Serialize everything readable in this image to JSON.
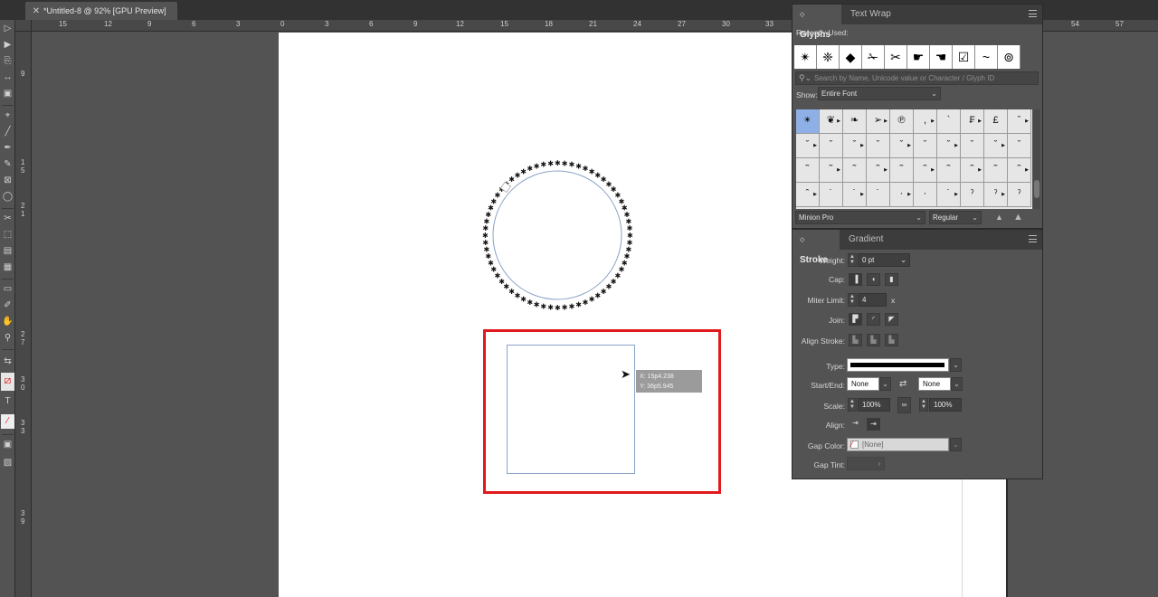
{
  "document_tab": {
    "close_icon": "close-icon",
    "title": "*Untitled-8 @ 92% [GPU Preview]"
  },
  "rulers": {
    "horizontal_labels": [
      "15",
      "12",
      "9",
      "6",
      "3",
      "0",
      "3",
      "6",
      "9",
      "12",
      "15",
      "18",
      "21",
      "24",
      "27",
      "30",
      "33",
      "54",
      "57"
    ],
    "vertical_labels": [
      "9",
      "1 5",
      "2 1",
      "2 7",
      "3 0",
      "3 3",
      "3 9"
    ]
  },
  "canvas": {
    "coordinate_readout": {
      "x": "X: 15p4.238",
      "y": "Y: 36p5.945"
    }
  },
  "glyphs_panel": {
    "tabs": [
      "Glyphs",
      "Text Wrap"
    ],
    "recently_used_label": "Recently Used:",
    "recently_used": [
      "✴",
      "❈",
      "◆",
      "✁",
      "✂",
      "☛",
      "☚",
      "☑",
      "~",
      "⊚"
    ],
    "search_placeholder": "Search by Name, Unicode value or Character / Glyph ID",
    "show_label": "Show:",
    "show_value": "Entire Font",
    "grid": [
      [
        "✴",
        "❦",
        "❧",
        "➢",
        "℗",
        ",",
        "`",
        "₣",
        "£",
        "ˇ"
      ],
      [
        "ˇ",
        "ˇ",
        "ˇ",
        "ˇ",
        "ˇ",
        "ˇ",
        "ˇ",
        "ˇ",
        "ˇ",
        "ˇ"
      ],
      [
        "˜",
        "˜",
        "˜",
        "˜",
        "˜",
        "˜",
        "˜",
        "˜",
        "˜",
        "˜"
      ],
      [
        "ˆ",
        "˙",
        "˙",
        "˙",
        "·",
        "·",
        "˙",
        "ˀ",
        "ˀ",
        "ˀ"
      ]
    ],
    "font_family": "Minion Pro",
    "font_style": "Regular"
  },
  "stroke_panel": {
    "tabs": [
      "Stroke",
      "Gradient"
    ],
    "weight_label": "Weight:",
    "weight_value": "0 pt",
    "cap_label": "Cap:",
    "miter_label": "Miter Limit:",
    "miter_value": "4",
    "miter_unit": "x",
    "join_label": "Join:",
    "align_stroke_label": "Align Stroke:",
    "type_label": "Type:",
    "start_end_label": "Start/End:",
    "start_value": "None",
    "end_value": "None",
    "scale_label": "Scale:",
    "scale_start": "100%",
    "scale_end": "100%",
    "align_label": "Align:",
    "gap_color_label": "Gap Color:",
    "gap_color_value": "[None]",
    "gap_tint_label": "Gap Tint:"
  }
}
